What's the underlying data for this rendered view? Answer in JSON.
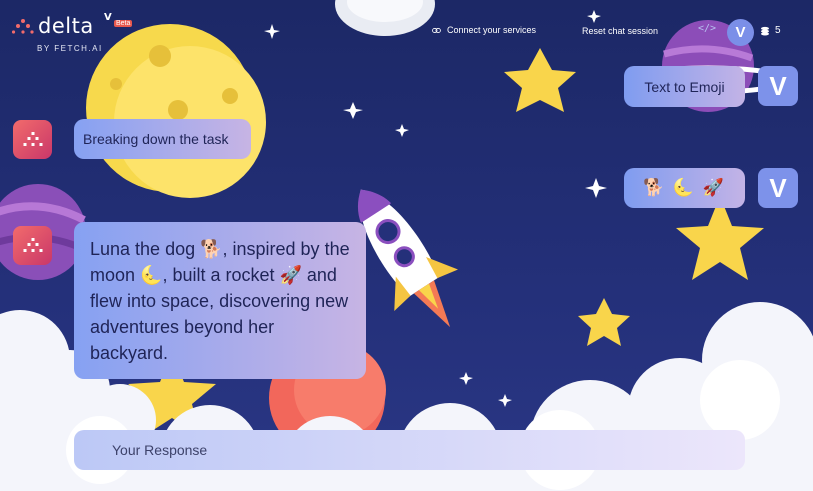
{
  "app": {
    "logo_text": "delta",
    "logo_superscript": "V",
    "beta_badge": "Beta",
    "byline": "BY FETCH.AI"
  },
  "header": {
    "connect_label": "Connect your services",
    "reset_label": "Reset chat session",
    "code_icon_label": "</>",
    "avatar_initial": "V",
    "credits": "5"
  },
  "chat": {
    "messages": [
      {
        "role": "user",
        "text": "Text to Emoji"
      },
      {
        "role": "agent",
        "text": "Breaking down the task"
      },
      {
        "role": "user",
        "text": "🐕 🌜 🚀"
      },
      {
        "role": "agent",
        "text": "Luna the dog 🐕, inspired by the moon 🌜, built a rocket 🚀 and flew into space, discovering new adventures beyond her backyard."
      }
    ],
    "user_avatar_initial": "V"
  },
  "composer": {
    "placeholder": "Your Response",
    "value": ""
  },
  "colors": {
    "background": "#1f2a6b",
    "accent": "#7d92ea",
    "agent_avatar": "#e0536c"
  }
}
